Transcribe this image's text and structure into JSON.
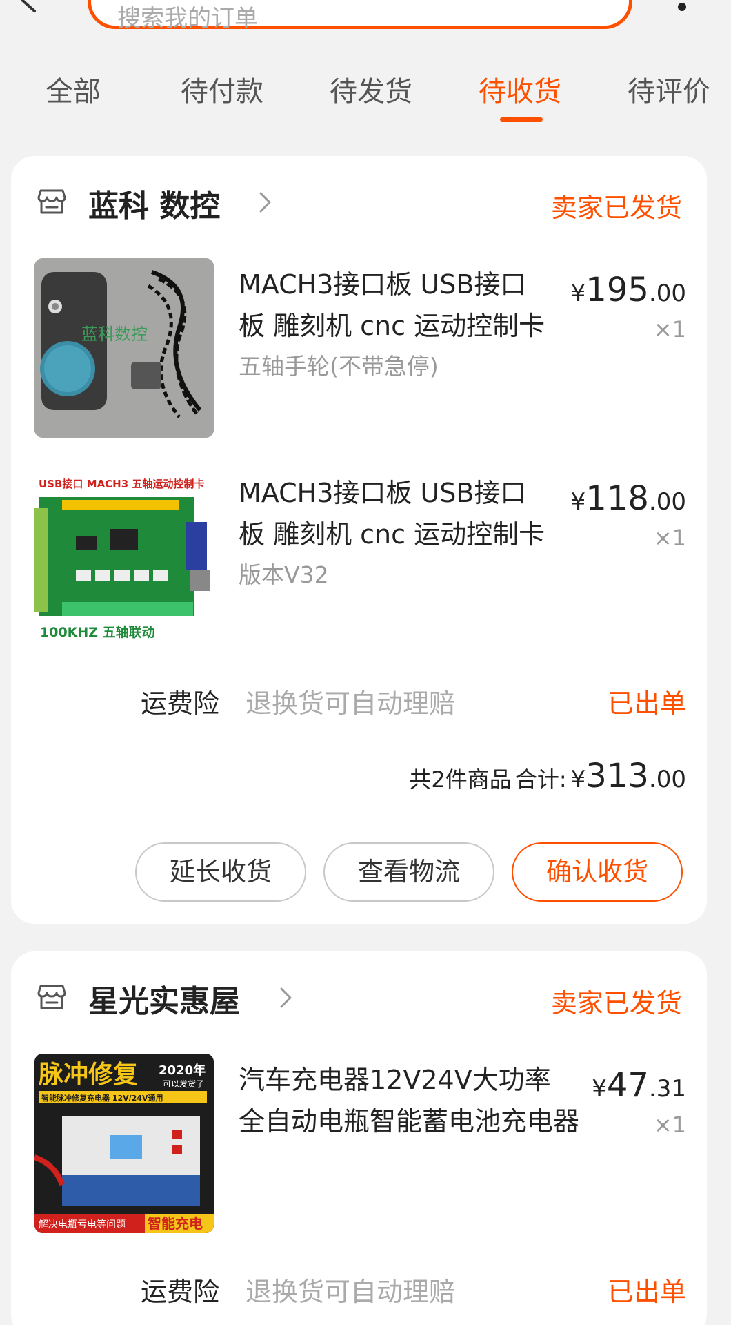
{
  "search": {
    "placeholder": "搜索我的订单"
  },
  "tabs": [
    {
      "label": "全部"
    },
    {
      "label": "待付款"
    },
    {
      "label": "待发货"
    },
    {
      "label": "待收货",
      "active": true
    },
    {
      "label": "待评价"
    }
  ],
  "colors": {
    "accent": "#ff5000",
    "muted": "#999999",
    "background": "#f2f2f2"
  },
  "orders": [
    {
      "shop_name": "蓝科 数控",
      "status": "卖家已发货",
      "items": [
        {
          "title_line1": "MACH3接口板 USB接口",
          "title_line2": "板 雕刻机 cnc 运动控制卡",
          "sku": "五轴手轮(不带急停)",
          "price_currency": "¥",
          "price_int": "195",
          "price_dec": ".00",
          "qty": "×1",
          "thumb_text": "蓝科数控"
        },
        {
          "title_line1": "MACH3接口板 USB接口",
          "title_line2": "板 雕刻机 cnc 运动控制卡",
          "sku": "版本V32",
          "price_currency": "¥",
          "price_int": "118",
          "price_dec": ".00",
          "qty": "×1",
          "thumb_top_text": "USB接口 MACH3 五轴运动控制卡",
          "thumb_bottom_text": "100KHZ  五轴联动"
        }
      ],
      "insurance": {
        "label": "运费险",
        "desc": "退换货可自动理赔",
        "status": "已出单"
      },
      "summary": {
        "count_label": "共2件商品",
        "total_label": "合计:",
        "currency": "¥",
        "total_int": "313",
        "total_dec": ".00"
      },
      "buttons": {
        "extend": "延长收货",
        "logistics": "查看物流",
        "confirm": "确认收货"
      }
    },
    {
      "shop_name": "星光实惠屋",
      "status": "卖家已发货",
      "items": [
        {
          "title_line1": "汽车充电器12V24V大功率",
          "title_line2": "全自动电瓶智能蓄电池充电器",
          "price_currency": "¥",
          "price_int": "47",
          "price_dec": ".31",
          "qty": "×1",
          "thumb_top_text": "脉冲修复",
          "thumb_year_text": "2020年",
          "thumb_year_sub": "可以发货了",
          "thumb_band_text": "智能脉冲修复充电器 12V/24V通用",
          "thumb_bottom_left": "解决电瓶亏电等问题",
          "thumb_bottom_right": "智能充电"
        }
      ],
      "insurance": {
        "label": "运费险",
        "desc": "退换货可自动理赔",
        "status": "已出单"
      }
    }
  ]
}
